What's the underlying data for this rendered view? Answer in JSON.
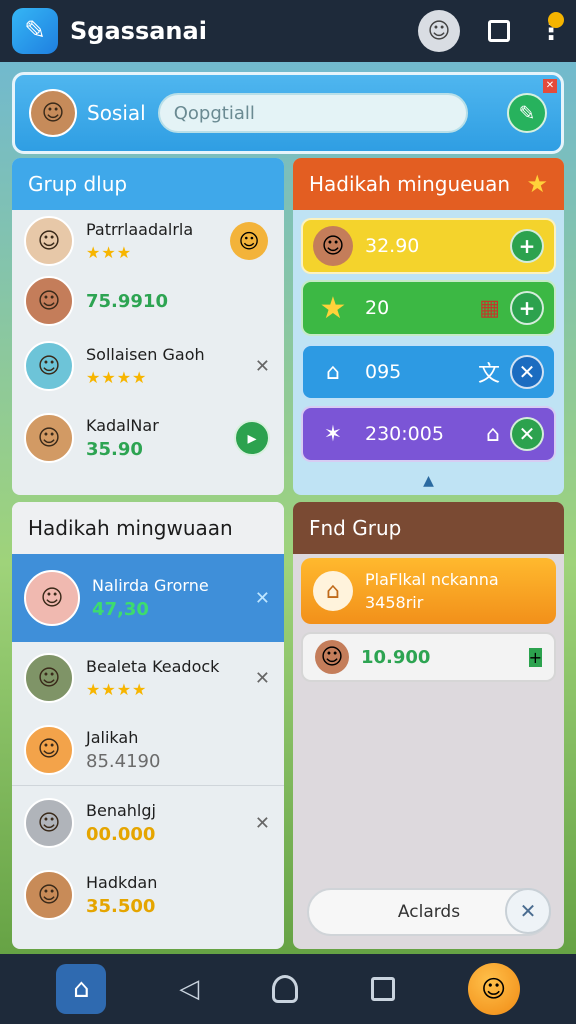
{
  "app": {
    "title": "Sgassanai",
    "icon": "chat-bubbles-icon"
  },
  "social": {
    "label": "Sosial",
    "input_placeholder": "Qopgtiall"
  },
  "group_panel": {
    "title": "Grup dlup",
    "members": [
      {
        "name": "Patrrlaadalrla",
        "stars": "★★★",
        "value": ""
      },
      {
        "name": "",
        "stars": "",
        "value": "75.9910"
      },
      {
        "name": "Sollaisen Gaoh",
        "stars": "★★★★",
        "value": ""
      },
      {
        "name": "KadalNar",
        "stars": "",
        "value": "35.90"
      }
    ]
  },
  "weekly_reward_top": {
    "title": "Hadikah mingueuan",
    "rewards": [
      {
        "value": "32.90",
        "color": "#f3d22e"
      },
      {
        "value": "20",
        "color": "#3cb844"
      },
      {
        "value": "095",
        "color": "#2d9ae3"
      },
      {
        "value": "230:005",
        "color": "#7b55d6"
      }
    ]
  },
  "weekly_reward_bottom": {
    "title": "Hadikah mingwuaan",
    "items": [
      {
        "name": "Nalirda Grorne",
        "stars": "",
        "value": "47,30"
      },
      {
        "name": "Bealeta Keadock",
        "stars": "★★★★",
        "value": ""
      },
      {
        "name": "Jalikah",
        "stars": "",
        "value": "85.4190"
      },
      {
        "name": "Benahlgj",
        "stars": "",
        "value": "00.000"
      },
      {
        "name": "Hadkdan",
        "stars": "",
        "value": "35.500"
      }
    ]
  },
  "find_group": {
    "title": "Fnd Grup",
    "card1": {
      "label": "PlaFlkal nckanna",
      "value": "3458rir"
    },
    "card2": {
      "value": "10.900"
    },
    "search_label": "Aclards"
  },
  "nav": {
    "items": [
      "home",
      "back",
      "circle",
      "recents",
      "mascot"
    ]
  }
}
